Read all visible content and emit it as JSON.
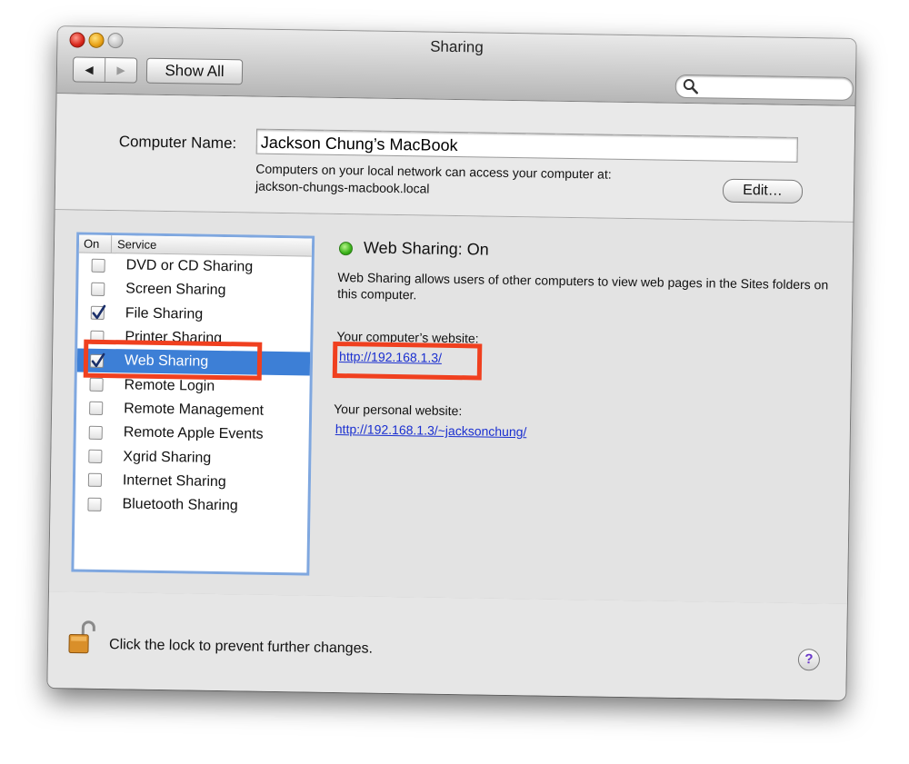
{
  "window": {
    "title": "Sharing"
  },
  "toolbar": {
    "back_icon": "back-arrow-icon",
    "forward_icon": "forward-arrow-icon",
    "show_all_label": "Show All",
    "search_placeholder": ""
  },
  "computer": {
    "label": "Computer Name:",
    "name": "Jackson Chung’s MacBook",
    "info_line1": "Computers on your local network can access your computer at:",
    "info_line2": "jackson-chungs-macbook.local",
    "edit_label": "Edit…"
  },
  "services": {
    "header_on": "On",
    "header_service": "Service",
    "items": [
      {
        "name": "DVD or CD Sharing",
        "checked": false
      },
      {
        "name": "Screen Sharing",
        "checked": false
      },
      {
        "name": "File Sharing",
        "checked": true
      },
      {
        "name": "Printer Sharing",
        "checked": false
      },
      {
        "name": "Web Sharing",
        "checked": true,
        "selected": true
      },
      {
        "name": "Remote Login",
        "checked": false
      },
      {
        "name": "Remote Management",
        "checked": false
      },
      {
        "name": "Remote Apple Events",
        "checked": false
      },
      {
        "name": "Xgrid Sharing",
        "checked": false
      },
      {
        "name": "Internet Sharing",
        "checked": false
      },
      {
        "name": "Bluetooth Sharing",
        "checked": false
      }
    ]
  },
  "detail": {
    "status_title": "Web Sharing: On",
    "status_color": "#3ab21a",
    "description": "Web Sharing allows users of other computers to view web pages in the Sites folders on this computer.",
    "site_label": "Your computer’s website:",
    "site_url": "http://192.168.1.3/",
    "personal_label": "Your personal website:",
    "personal_url": "http://192.168.1.3/~jacksonchung/"
  },
  "footer": {
    "lock_icon": "unlocked-padlock-icon",
    "lock_text": "Click the lock to prevent further changes.",
    "help_label": "?"
  },
  "annotations": {
    "highlight_color": "#f0401f"
  },
  "colors": {
    "selection": "#3d7fd6",
    "link": "#1a2fd0",
    "list_border": "#7fa7df"
  }
}
